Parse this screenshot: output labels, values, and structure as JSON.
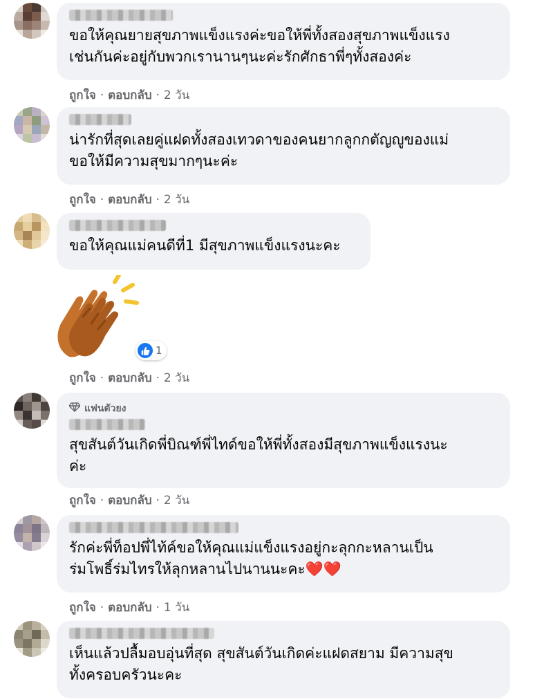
{
  "comments": [
    {
      "text": "ขอให้คุณยายสุขภาพแข็งแรงค่ะขอให้พี่ทั้งสองสุขภาพแข็งแรง\nเช่นกันค่ะอยู่กับพวกเรานานๆนะค่ะรักศักธาพี่ๆทั้งสองค่ะ",
      "like_label": "ถูกใจ",
      "reply_label": "ตอบกลับ",
      "time": "2 วัน"
    },
    {
      "text": "น่ารักที่สุดเลยคู่แฝดทั้งสองเทวดาของคนยากลูกกตัญญูของแม่\nขอให้มีความสุขมากๆนะค่ะ",
      "like_label": "ถูกใจ",
      "reply_label": "ตอบกลับ",
      "time": "2 วัน"
    },
    {
      "text": "ขอให้คุณแม่คนดีที่1 มีสุขภาพแข็งแรงนะคะ",
      "like_label": "ถูกใจ",
      "reply_label": "ตอบกลับ",
      "time": "2 วัน",
      "sticker": "clapping-hands-icon",
      "reaction_icon": "like-icon",
      "reaction_count": "1"
    },
    {
      "badge": "แฟนตัวยง",
      "badge_icon": "diamond-icon",
      "text": "สุขสันต์วันเกิดพี่บิณฑ์พี่ไทด์ขอให้พี่ทั้งสองมีสุขภาพแข็งแรงนะ\nค่ะ",
      "like_label": "ถูกใจ",
      "reply_label": "ตอบกลับ",
      "time": "2 วัน"
    },
    {
      "text": "รักค่ะพี่ท็อปพี่ไท้ค์ขอให้คุณแม่แข็งแรงอยู่กะลุกกะหลานเป็น\nร่มโพธิ์ร่มไทรให้ลุกหลานไปนานนะคะ❤️❤️",
      "like_label": "ถูกใจ",
      "reply_label": "ตอบกลับ",
      "time": "1 วัน"
    },
    {
      "text": "เห็นแล้วปลื้มอบอุ่นที่สุด สุขสันต์วันเกิดค่ะแฝดสยาม มีความสุข\nทั้งครอบครัวนะคะ"
    }
  ],
  "separator": "·",
  "colors": {
    "bubble": "#f0f2f5",
    "meta_text": "#65676b",
    "like_blue": "#1877f2"
  }
}
